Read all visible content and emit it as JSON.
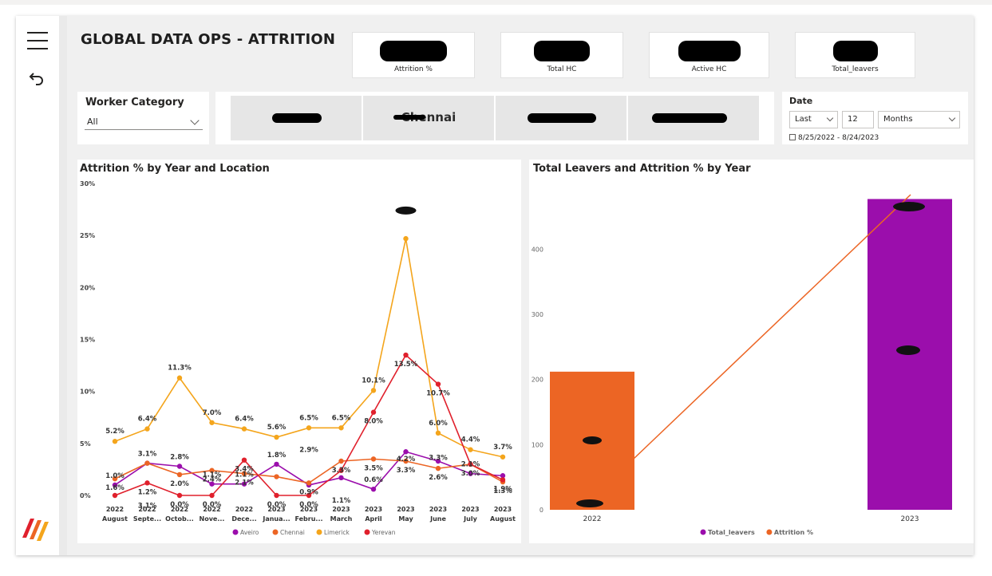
{
  "header": {
    "title": "GLOBAL DATA OPS - ATTRITION"
  },
  "nav": {
    "menu_icon": "hamburger-icon",
    "back_icon": "undo-arrow-icon",
    "logo_icon": "brand-slash-logo"
  },
  "kpi_cards": [
    {
      "label": "Attrition %"
    },
    {
      "label": "Total HC"
    },
    {
      "label": "Active HC"
    },
    {
      "label": "Total_leavers"
    }
  ],
  "worker_category": {
    "title": "Worker Category",
    "value": "All"
  },
  "locations": [
    {
      "label": ""
    },
    {
      "label": "Chennai"
    },
    {
      "label": ""
    },
    {
      "label": ""
    }
  ],
  "date_filter": {
    "title": "Date",
    "mode": "Last",
    "count": "12",
    "unit": "Months",
    "range": "8/25/2022 - 8/24/2023"
  },
  "colors": {
    "aveiro": "#9b0eac",
    "chennai": "#ec6524",
    "limerick": "#f4a51c",
    "yerevan": "#e0202c",
    "total_leavers": "#9b0eac",
    "attrition": "#ec6524"
  },
  "line_chart": {
    "title": "Attrition % by Year and Location",
    "chart_data": {
      "type": "line",
      "title": "Attrition % by Year and Location",
      "x": [
        {
          "year": "2022",
          "month": "August"
        },
        {
          "year": "2022",
          "month": "Septe..."
        },
        {
          "year": "2022",
          "month": "Octob..."
        },
        {
          "year": "2022",
          "month": "Nove..."
        },
        {
          "year": "2022",
          "month": "Dece..."
        },
        {
          "year": "2023",
          "month": "Janua..."
        },
        {
          "year": "2023",
          "month": "Febru..."
        },
        {
          "year": "2023",
          "month": "March"
        },
        {
          "year": "2023",
          "month": "April"
        },
        {
          "year": "2023",
          "month": "May"
        },
        {
          "year": "2023",
          "month": "June"
        },
        {
          "year": "2023",
          "month": "July"
        },
        {
          "year": "2023",
          "month": "August"
        }
      ],
      "y_ticks": [
        "0%",
        "5%",
        "10%",
        "15%",
        "20%",
        "25%",
        "30%"
      ],
      "ylim": [
        0,
        30
      ],
      "series": [
        {
          "name": "Aveiro",
          "color": "#9b0eac",
          "values": [
            1.0,
            3.1,
            2.8,
            1.1,
            1.1,
            3.0,
            1.0,
            1.7,
            0.6,
            4.2,
            3.3,
            2.1,
            1.9
          ],
          "labels": [
            "1.0%",
            "",
            "2.8%",
            "1.1%",
            "1.1%",
            "1.8%",
            "",
            "",
            "0.6%",
            "",
            "",
            "2.1%",
            ""
          ]
        },
        {
          "name": "Chennai",
          "color": "#ec6524",
          "values": [
            1.6,
            3.1,
            2.0,
            2.4,
            2.1,
            1.8,
            1.2,
            3.3,
            3.5,
            3.3,
            2.6,
            3.0,
            1.3
          ],
          "labels": [
            "1.6%",
            "",
            "2.0%",
            "2.4%",
            "2.1%",
            "",
            "0.9%",
            "3.3%",
            "3.5%",
            "3.3%",
            "2.6%",
            "3.0%",
            "1.3%"
          ]
        },
        {
          "name": "Limerick",
          "color": "#f4a51c",
          "values": [
            5.2,
            6.4,
            11.3,
            7.0,
            6.4,
            5.6,
            6.5,
            6.5,
            10.1,
            24.7,
            6.0,
            4.4,
            3.7
          ],
          "labels": [
            "5.2%",
            "6.4%",
            "11.3%",
            "7.0%",
            "6.4%",
            "5.6%",
            "6.5%",
            "6.5%",
            "10.1%",
            "",
            "6.0%",
            "4.4%",
            "3.7%"
          ]
        },
        {
          "name": "Yerevan",
          "color": "#e0202c",
          "values": [
            0.0,
            1.2,
            0.0,
            0.0,
            3.4,
            0.0,
            0.0,
            2.4,
            8.0,
            13.5,
            10.7,
            3.0,
            1.5
          ],
          "labels": [
            "",
            "1.2%",
            "0.0%",
            "0.0%",
            "3.4%",
            "0.0%",
            "0.0%",
            "",
            "8.0%",
            "13.5%",
            "10.7%",
            "",
            "1.9%"
          ]
        }
      ],
      "extra_labels": [
        "3.1%",
        "3.1%",
        "2.9%",
        "1.1%",
        "4.2%",
        "3.3%"
      ],
      "legend": [
        "Aveiro",
        "Chennai",
        "Limerick",
        "Yerevan"
      ]
    }
  },
  "combo_chart": {
    "title": "Total Leavers and Attrition % by Year",
    "chart_data": {
      "type": "bar",
      "title": "Total Leavers and Attrition % by Year",
      "categories": [
        "2022",
        "2023"
      ],
      "bar_series": {
        "name": "Total_leavers",
        "values": [
          212,
          477
        ]
      },
      "line_series": {
        "name": "Attrition %"
      },
      "y_ticks": [
        "0",
        "100",
        "200",
        "300",
        "400"
      ],
      "ylim": [
        0,
        480
      ],
      "legend": [
        "Total_leavers",
        "Attrition %"
      ]
    }
  }
}
